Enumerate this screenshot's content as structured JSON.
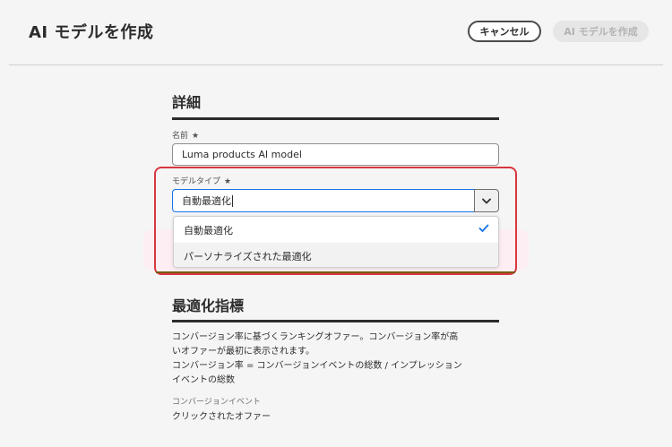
{
  "header": {
    "title": "AI モデルを作成",
    "cancel_label": "キャンセル",
    "create_label": "AI モデルを作成"
  },
  "details": {
    "heading": "詳細",
    "name_label": "名前",
    "name_required": "★",
    "name_value": "Luma products AI model",
    "model_type_label": "モデルタイプ",
    "model_type_required": "★",
    "model_type_value": "自動最適化",
    "options": [
      {
        "label": "自動最適化",
        "selected": true
      },
      {
        "label": "パーソナライズされた最適化",
        "selected": false
      }
    ]
  },
  "optimization": {
    "heading": "最適化指標",
    "description_line1": "コンバージョン率に基づくランキングオファー。コンバージョン率が高",
    "description_line2": "いオファーが最初に表示されます。",
    "formula_line1": "コンバージョン率 = コンバージョンイベントの総数 / インプレッション",
    "formula_line2": "イベントの総数",
    "event_label": "コンバージョンイベント",
    "event_value": "クリックされたオファー"
  },
  "colors": {
    "accent": "#1473e6",
    "highlight": "#d7373f",
    "text": "#2c2c2c",
    "background": "#f5f5f5"
  },
  "icons": {
    "chevron": "chevron-down-icon",
    "check": "checkmark-icon"
  }
}
